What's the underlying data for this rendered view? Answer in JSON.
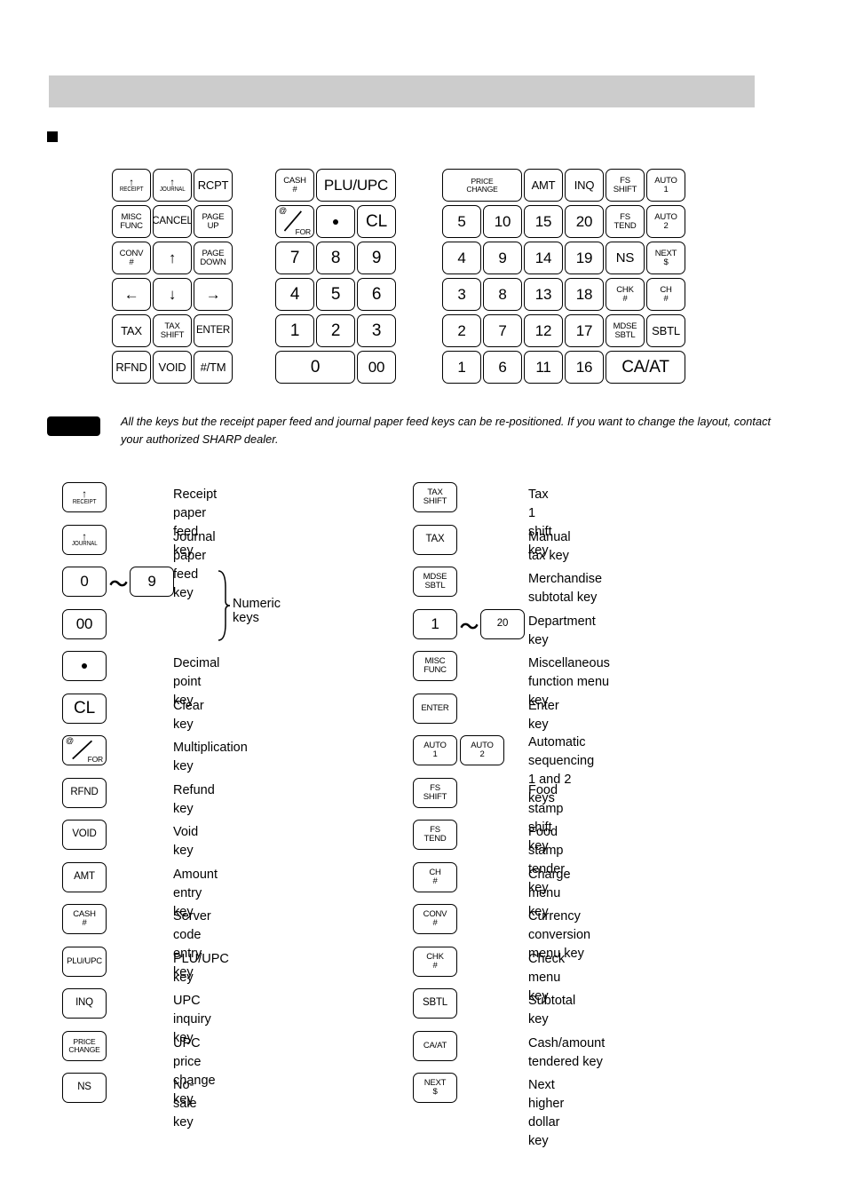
{
  "page": {
    "header_bar_color": "#cccccc",
    "bullet": "section-bullet"
  },
  "note": {
    "text": "All the keys but the receipt paper feed and journal paper feed keys can be re-positioned.  If you want to change the layout, contact your authorized SHARP dealer."
  },
  "keyboard": {
    "left_block": {
      "rows": [
        [
          {
            "id": "receipt",
            "top": "RECEIPT",
            "arrow": "↑"
          },
          {
            "id": "journal",
            "top": "JOURNAL",
            "arrow": "↑"
          },
          {
            "id": "rcpt",
            "label": "RCPT"
          }
        ],
        [
          {
            "id": "misc-func",
            "label": "MISC\nFUNC"
          },
          {
            "id": "cancel",
            "label": "CANCEL"
          },
          {
            "id": "page-up",
            "label": "PAGE\nUP"
          }
        ],
        [
          {
            "id": "conv-num",
            "label": "CONV\n#"
          },
          {
            "id": "arrow-up",
            "label": "↑"
          },
          {
            "id": "page-down",
            "label": "PAGE\nDOWN"
          }
        ],
        [
          {
            "id": "arrow-left",
            "label": "←"
          },
          {
            "id": "arrow-down",
            "label": "↓"
          },
          {
            "id": "arrow-right",
            "label": "→"
          }
        ],
        [
          {
            "id": "tax",
            "label": "TAX"
          },
          {
            "id": "tax-shift",
            "label": "TAX\nSHIFT"
          },
          {
            "id": "enter",
            "label": "ENTER"
          }
        ],
        [
          {
            "id": "rfnd",
            "label": "RFND"
          },
          {
            "id": "void",
            "label": "VOID"
          },
          {
            "id": "hash-tm",
            "label": "#/TM"
          }
        ]
      ]
    },
    "numeric_block": {
      "cash_num": "CASH\n#",
      "plu_upc": "PLU/UPC",
      "at_for_at": "@",
      "at_for_for": "FOR",
      "cl": "CL",
      "decimal": "•",
      "rows": [
        [
          "7",
          "8",
          "9"
        ],
        [
          "4",
          "5",
          "6"
        ],
        [
          "1",
          "2",
          "3"
        ]
      ],
      "zero": "0",
      "double_zero": "00"
    },
    "right_block": {
      "price_change": "PRICE\nCHANGE",
      "amt": "AMT",
      "inq": "INQ",
      "fs_shift": "FS\nSHIFT",
      "auto1": "AUTO\n1",
      "dept_columns": [
        [
          "5",
          "4",
          "3",
          "2",
          "1"
        ],
        [
          "10",
          "9",
          "8",
          "7",
          "6"
        ],
        [
          "15",
          "14",
          "13",
          "12",
          "11"
        ],
        [
          "20",
          "19",
          "18",
          "17",
          "16"
        ]
      ],
      "fs_tend": "FS\nTEND",
      "auto2": "AUTO\n2",
      "ns": "NS",
      "next_dollar": "NEXT\n$",
      "chk_num": "CHK\n#",
      "ch_num": "CH\n#",
      "mdse_sbtl": "MDSE\nSBTL",
      "sbtl": "SBTL",
      "ca_at": "CA/AT"
    }
  },
  "legend": {
    "left": [
      {
        "key": "RECEIPT",
        "key_kind": "arrow",
        "desc": "Receipt paper feed key"
      },
      {
        "key": "JOURNAL",
        "key_kind": "arrow",
        "desc": "Journal paper feed key"
      },
      {
        "key": "0",
        "key2": "9",
        "key_kind": "range",
        "tilde": "～",
        "desc": "Numeric keys"
      },
      {
        "key": "00",
        "key_kind": "plain",
        "desc": ""
      },
      {
        "key": "•",
        "key_kind": "dot",
        "desc": "Decimal point key"
      },
      {
        "key": "CL",
        "key_kind": "plain",
        "desc": "Clear key"
      },
      {
        "key": "@/FOR",
        "key_kind": "atfor",
        "desc": "Multiplication key"
      },
      {
        "key": "RFND",
        "key_kind": "plain",
        "desc": "Refund key"
      },
      {
        "key": "VOID",
        "key_kind": "plain",
        "desc": "Void key"
      },
      {
        "key": "AMT",
        "key_kind": "plain",
        "desc": "Amount entry key"
      },
      {
        "key": "CASH\n#",
        "key_kind": "plain",
        "desc": "Server code entry key"
      },
      {
        "key": "PLU/UPC",
        "key_kind": "plain",
        "desc": "PLU/UPC key"
      },
      {
        "key": "INQ",
        "key_kind": "plain",
        "desc": "UPC inquiry key"
      },
      {
        "key": "PRICE\nCHANGE",
        "key_kind": "plain",
        "desc": "UPC price change key"
      },
      {
        "key": "NS",
        "key_kind": "plain",
        "desc": "No-sale key"
      }
    ],
    "right": [
      {
        "key": "TAX\nSHIFT",
        "key_kind": "plain",
        "desc": "Tax 1 shift key"
      },
      {
        "key": "TAX",
        "key_kind": "plain",
        "desc": "Manual tax key"
      },
      {
        "key": "MDSE\nSBTL",
        "key_kind": "plain",
        "desc": "Merchandise subtotal key"
      },
      {
        "key": "1",
        "key2": "20",
        "key_kind": "range",
        "tilde": "～",
        "desc": "Department key"
      },
      {
        "key": "MISC\nFUNC",
        "key_kind": "plain",
        "desc": "Miscellaneous function menu key"
      },
      {
        "key": "ENTER",
        "key_kind": "plain",
        "desc": "Enter key"
      },
      {
        "key": "AUTO\n1",
        "key2": "AUTO\n2",
        "key_kind": "pair",
        "desc": "Automatic sequencing\n1 and 2 keys"
      },
      {
        "key": "FS\nSHIFT",
        "key_kind": "plain",
        "desc": "Food stamp shift key"
      },
      {
        "key": "FS\nTEND",
        "key_kind": "plain",
        "desc": "Food stamp tender key"
      },
      {
        "key": "CH\n#",
        "key_kind": "plain",
        "desc": "Charge menu key"
      },
      {
        "key": "CONV\n#",
        "key_kind": "plain",
        "desc": "Currency conversion menu key"
      },
      {
        "key": "CHK\n#",
        "key_kind": "plain",
        "desc": "Check menu key"
      },
      {
        "key": "SBTL",
        "key_kind": "plain",
        "desc": "Subtotal key"
      },
      {
        "key": "CA/AT",
        "key_kind": "plain",
        "desc": "Cash/amount tendered key"
      },
      {
        "key": "NEXT\n$",
        "key_kind": "plain",
        "desc": "Next higher dollar key"
      }
    ]
  }
}
